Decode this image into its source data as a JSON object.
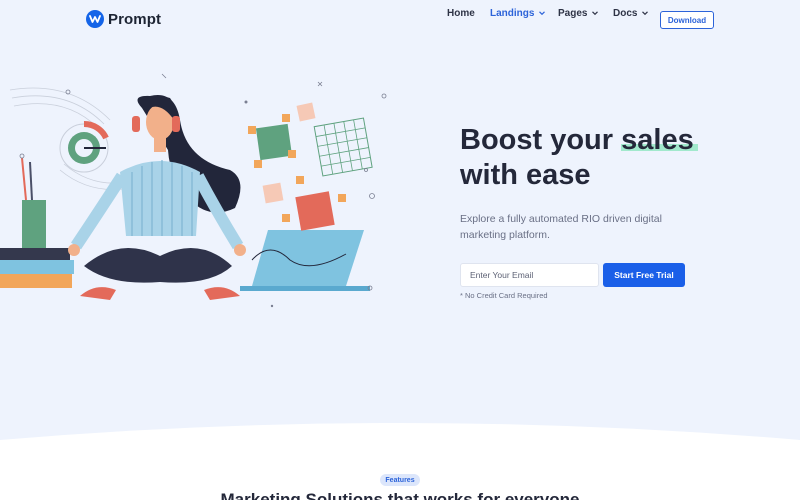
{
  "brand": {
    "name": "Prompt",
    "accent": "#1a5fe8"
  },
  "nav": {
    "items": [
      {
        "label": "Home",
        "active": false,
        "dropdown": false
      },
      {
        "label": "Landings",
        "active": true,
        "dropdown": true
      },
      {
        "label": "Pages",
        "active": false,
        "dropdown": true
      },
      {
        "label": "Docs",
        "active": false,
        "dropdown": true
      }
    ],
    "download_label": "Download"
  },
  "hero": {
    "title_part1": "Boost your ",
    "title_highlight": "sales",
    "title_part2": "with ease",
    "subtitle": "Explore a fully automated RIO driven digital marketing platform.",
    "email_placeholder": "Enter Your Email",
    "cta_label": "Start Free Trial",
    "note": "* No Credit Card Required",
    "illustration": "woman-meditating-illustration"
  },
  "features": {
    "badge": "Features",
    "title": "Marketing Solutions that works for everyone"
  }
}
